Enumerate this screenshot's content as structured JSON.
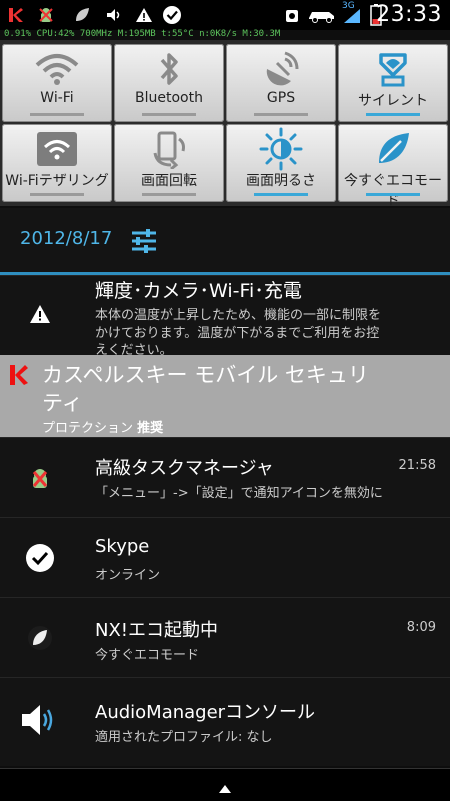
{
  "statusbar": {
    "clock": "23:33",
    "network_label": "3G",
    "icons": [
      "kaspersky-icon",
      "android-icon",
      "leaf-icon",
      "sound-icon",
      "warning-icon",
      "check-icon",
      "alarm-icon",
      "car-icon",
      "signal-icon",
      "battery-icon"
    ]
  },
  "debug_text": "0.91% CPU:42% 700MHz M:195MB t:55°C n:0K8/s M:30.3M",
  "toggles": [
    {
      "label": "Wi-Fi",
      "icon": "wifi-icon",
      "active": false
    },
    {
      "label": "Bluetooth",
      "icon": "bluetooth-icon",
      "active": false
    },
    {
      "label": "GPS",
      "icon": "gps-icon",
      "active": false
    },
    {
      "label": "サイレント",
      "icon": "silent-icon",
      "active": true
    },
    {
      "label": "Wi-Fiテザリング",
      "icon": "wifi-tether-icon",
      "active": false
    },
    {
      "label": "画面回転",
      "icon": "rotate-icon",
      "active": false
    },
    {
      "label": "画面明るさ",
      "icon": "brightness-icon",
      "active": true
    },
    {
      "label": "今すぐエコモード",
      "icon": "eco-icon",
      "active": true
    }
  ],
  "date_bar": {
    "date": "2012/8/17"
  },
  "notifications": [
    {
      "title": "輝度･カメラ･Wi-Fi･充電",
      "lines": [
        "本体の温度が上昇したため、機能の一部に制限を",
        "かけております。温度が下がるまでご利用をお控",
        "えください。"
      ]
    },
    {
      "title_line1": "カスペルスキー モバイル セキュリ",
      "title_line2": "ティ",
      "sub": "プロテクション",
      "sub_bold": "推奨"
    },
    {
      "title": "高級タスクマネージャ",
      "text": "「メニュー」->「設定」で通知アイコンを無効に",
      "time": "21:58"
    },
    {
      "title": "Skype",
      "text": "オンライン"
    },
    {
      "title": "NX!エコ起動中",
      "text": "今すぐエコモード",
      "time": "8:09"
    },
    {
      "title": "AudioManagerコンソール",
      "text": "適用されたプロファイル: なし"
    }
  ]
}
